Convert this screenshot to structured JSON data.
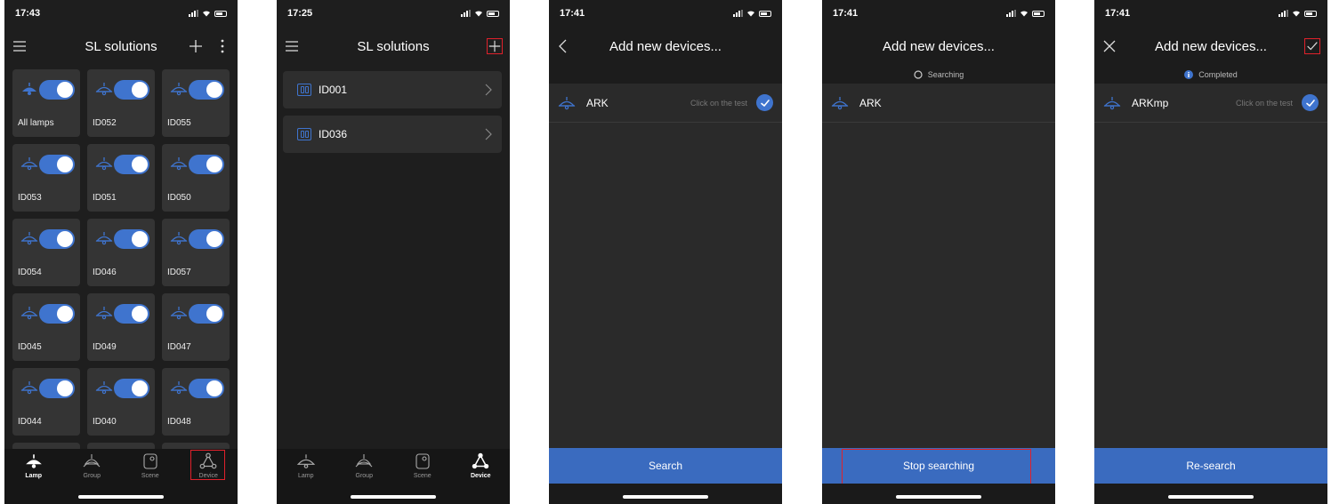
{
  "colors": {
    "accent": "#3f74ce",
    "highlight": "#e0212b",
    "background": "#1e1e1e"
  },
  "screens": [
    {
      "time": "17:43",
      "title": "SL solutions",
      "lamps": [
        {
          "label": "All lamps"
        },
        {
          "label": "ID052"
        },
        {
          "label": "ID055"
        },
        {
          "label": "ID053"
        },
        {
          "label": "ID051"
        },
        {
          "label": "ID050"
        },
        {
          "label": "ID054"
        },
        {
          "label": "ID046"
        },
        {
          "label": "ID057"
        },
        {
          "label": "ID045"
        },
        {
          "label": "ID049"
        },
        {
          "label": "ID047"
        },
        {
          "label": "ID044"
        },
        {
          "label": "ID040"
        },
        {
          "label": "ID048"
        }
      ],
      "tabs": [
        {
          "label": "Lamp",
          "active": true
        },
        {
          "label": "Group"
        },
        {
          "label": "Scene"
        },
        {
          "label": "Device",
          "highlighted": true
        }
      ]
    },
    {
      "time": "17:25",
      "title": "SL solutions",
      "devices": [
        {
          "label": "ID001"
        },
        {
          "label": "ID036"
        }
      ],
      "tabs": [
        {
          "label": "Lamp"
        },
        {
          "label": "Group"
        },
        {
          "label": "Scene"
        },
        {
          "label": "Device",
          "active": true
        }
      ]
    },
    {
      "time": "17:41",
      "title": "Add new devices...",
      "found": {
        "name": "ARK",
        "hint": "Click on the test"
      },
      "button": "Search"
    },
    {
      "time": "17:41",
      "title": "Add new devices...",
      "status": "Searching",
      "found": {
        "name": "ARK"
      },
      "button": "Stop searching"
    },
    {
      "time": "17:41",
      "title": "Add new devices...",
      "status": "Completed",
      "found": {
        "name": "ARKmp",
        "hint": "Click on the test"
      },
      "button": "Re-search"
    }
  ]
}
